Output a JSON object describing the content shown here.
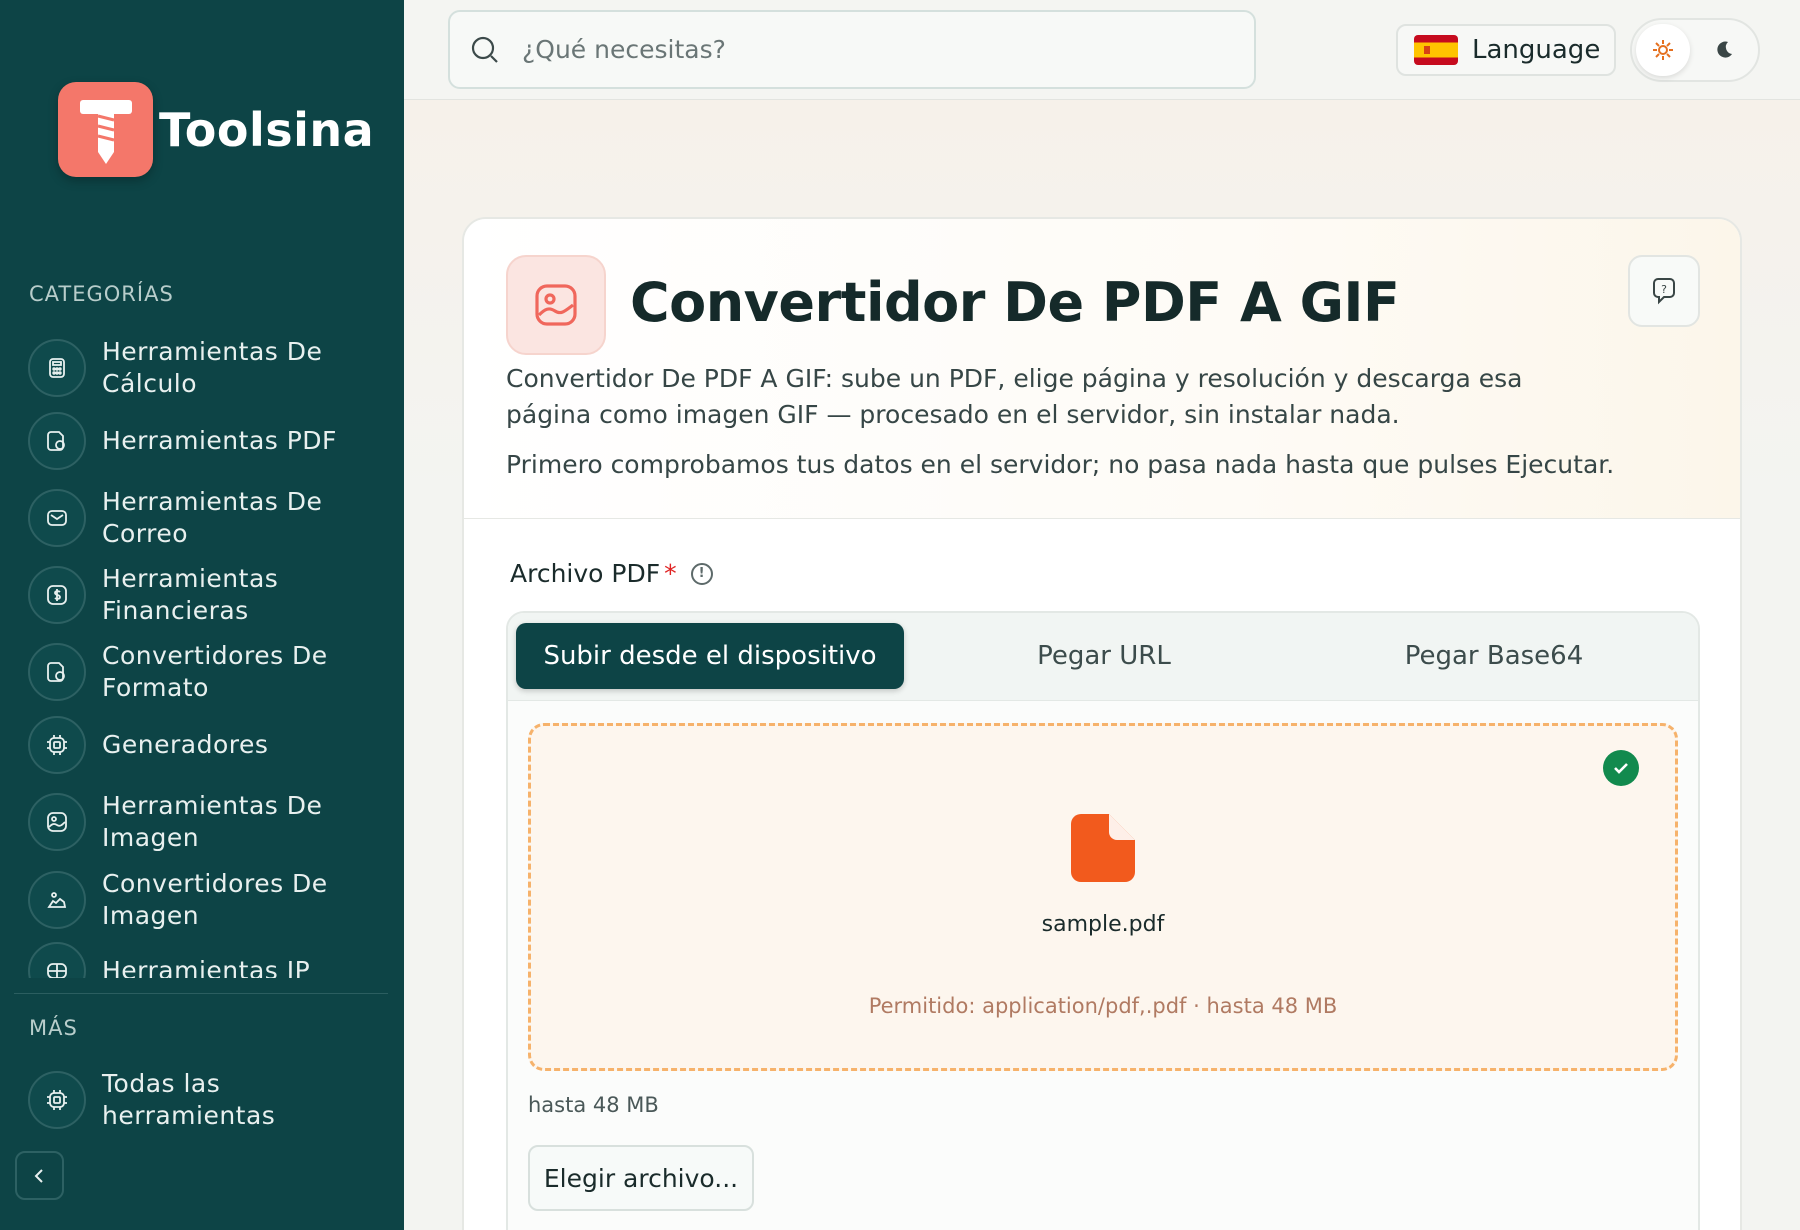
{
  "brand": {
    "name": "Toolsina"
  },
  "sidebar": {
    "categories_title": "CATEGORÍAS",
    "items": [
      {
        "label_line1": "Herramientas De",
        "label_line2": "Cálculo",
        "icon": "calculator-icon"
      },
      {
        "label_line1": "Herramientas PDF",
        "label_line2": "",
        "icon": "pdf-icon"
      },
      {
        "label_line1": "Herramientas De",
        "label_line2": "Correo",
        "icon": "mail-icon"
      },
      {
        "label_line1": "Herramientas",
        "label_line2": "Financieras",
        "icon": "dollar-icon"
      },
      {
        "label_line1": "Convertidores De",
        "label_line2": "Formato",
        "icon": "convert-icon"
      },
      {
        "label_line1": "Generadores",
        "label_line2": "",
        "icon": "chip-icon"
      },
      {
        "label_line1": "Herramientas De",
        "label_line2": "Imagen",
        "icon": "image-icon"
      },
      {
        "label_line1": "Convertidores De",
        "label_line2": "Imagen",
        "icon": "image-convert-icon"
      },
      {
        "label_line1": "Herramientas IP",
        "label_line2": "",
        "icon": "network-icon"
      }
    ],
    "more_title": "MÁS",
    "more_items": [
      {
        "label_line1": "Todas las",
        "label_line2": "herramientas",
        "icon": "chip-icon"
      }
    ]
  },
  "topbar": {
    "search_placeholder": "¿Qué necesitas?",
    "language_label": "Language"
  },
  "tool": {
    "title": "Convertidor De PDF A GIF",
    "description": "Convertidor De PDF A GIF: sube un PDF, elige página y resolución y descarga esa página como imagen GIF — procesado en el servidor, sin instalar nada.",
    "note": "Primero comprobamos tus datos en el servidor; no pasa nada hasta que pulses Ejecutar.",
    "field_label": "Archivo PDF",
    "required_mark": "*",
    "tabs": [
      {
        "label": "Subir desde el dispositivo",
        "active": true
      },
      {
        "label": "Pegar URL",
        "active": false
      },
      {
        "label": "Pegar Base64",
        "active": false
      }
    ],
    "file_name": "sample.pdf",
    "allowed_text": "Permitido: application/pdf,.pdf · hasta 48 MB",
    "size_note": "hasta 48 MB",
    "choose_button": "Elegir archivo..."
  },
  "colors": {
    "sidebar_bg": "#0d4446",
    "brand_accent": "#f4776a",
    "file_icon": "#f25a1d",
    "success": "#128a4e",
    "dropzone_border": "#f6b26b"
  }
}
